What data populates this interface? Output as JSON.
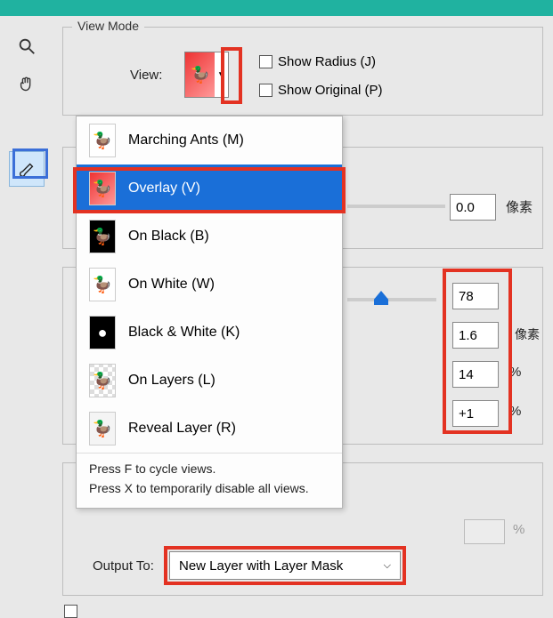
{
  "viewmode": {
    "legend": "View Mode",
    "view_label": "View:",
    "show_radius": "Show Radius (J)",
    "show_original": "Show Original (P)"
  },
  "dropdown": {
    "items": [
      {
        "label": "Marching Ants (M)"
      },
      {
        "label": "Overlay (V)"
      },
      {
        "label": "On Black (B)"
      },
      {
        "label": "On White (W)"
      },
      {
        "label": "Black & White (K)"
      },
      {
        "label": "On Layers (L)"
      },
      {
        "label": "Reveal Layer (R)"
      }
    ],
    "hint1": "Press F to cycle views.",
    "hint2": "Press X to temporarily disable all views."
  },
  "fields": {
    "val0": "0.0",
    "unit0": "像素",
    "val1": "78",
    "val2": "1.6",
    "unit2": "像素",
    "val3": "14",
    "unit3": "%",
    "val4": "+1",
    "unit4": "%",
    "unit5": "%"
  },
  "output": {
    "label": "Output To:",
    "value": "New Layer with Layer Mask"
  }
}
